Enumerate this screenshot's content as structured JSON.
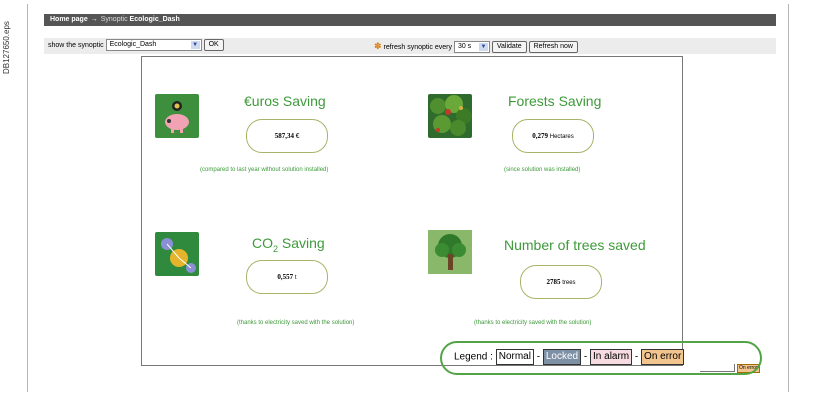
{
  "side_label": "DB127650.eps",
  "header": {
    "home": "Home page",
    "arrow": "→",
    "synoptic_prefix": "Synoptic",
    "synoptic_name": "Ecologic_Dash"
  },
  "toolbar": {
    "show_label": "show the synoptic",
    "synoptic_select": "Ecologic_Dash",
    "ok": "OK",
    "refresh_label": "refresh synoptic every",
    "refresh_select": "30 s",
    "validate": "Validate",
    "refresh_now": "Refresh now"
  },
  "tiles": [
    {
      "title": "€uros Saving",
      "value": "587,34 €",
      "unit": "",
      "note": "(compared to last year without solution installed)",
      "icon": "piggy-bank-icon"
    },
    {
      "title": "Forests Saving",
      "value": "0,279",
      "unit": "Hectares",
      "note": "(since solution was installed)",
      "icon": "forest-icon"
    },
    {
      "title_main": "CO",
      "title_sub": "2",
      "title_rest": " Saving",
      "value": "0,557",
      "unit": "t",
      "note": "(thanks to electricity saved with the solution)",
      "icon": "molecule-icon"
    },
    {
      "title": "Number of trees saved",
      "value": "2785",
      "unit": "trees",
      "note": "(thanks to electricity saved with the solution)",
      "icon": "tree-icon"
    }
  ],
  "legend": {
    "label": "Legend :",
    "normal": "Normal",
    "locked": "Locked",
    "alarm": "In alarm",
    "error": "On error",
    "sep": "-"
  },
  "mini_error": "On error",
  "colors": {
    "accent_green": "#3e9a3a",
    "legend_outline": "#52a447",
    "header_bar": "#555555"
  }
}
